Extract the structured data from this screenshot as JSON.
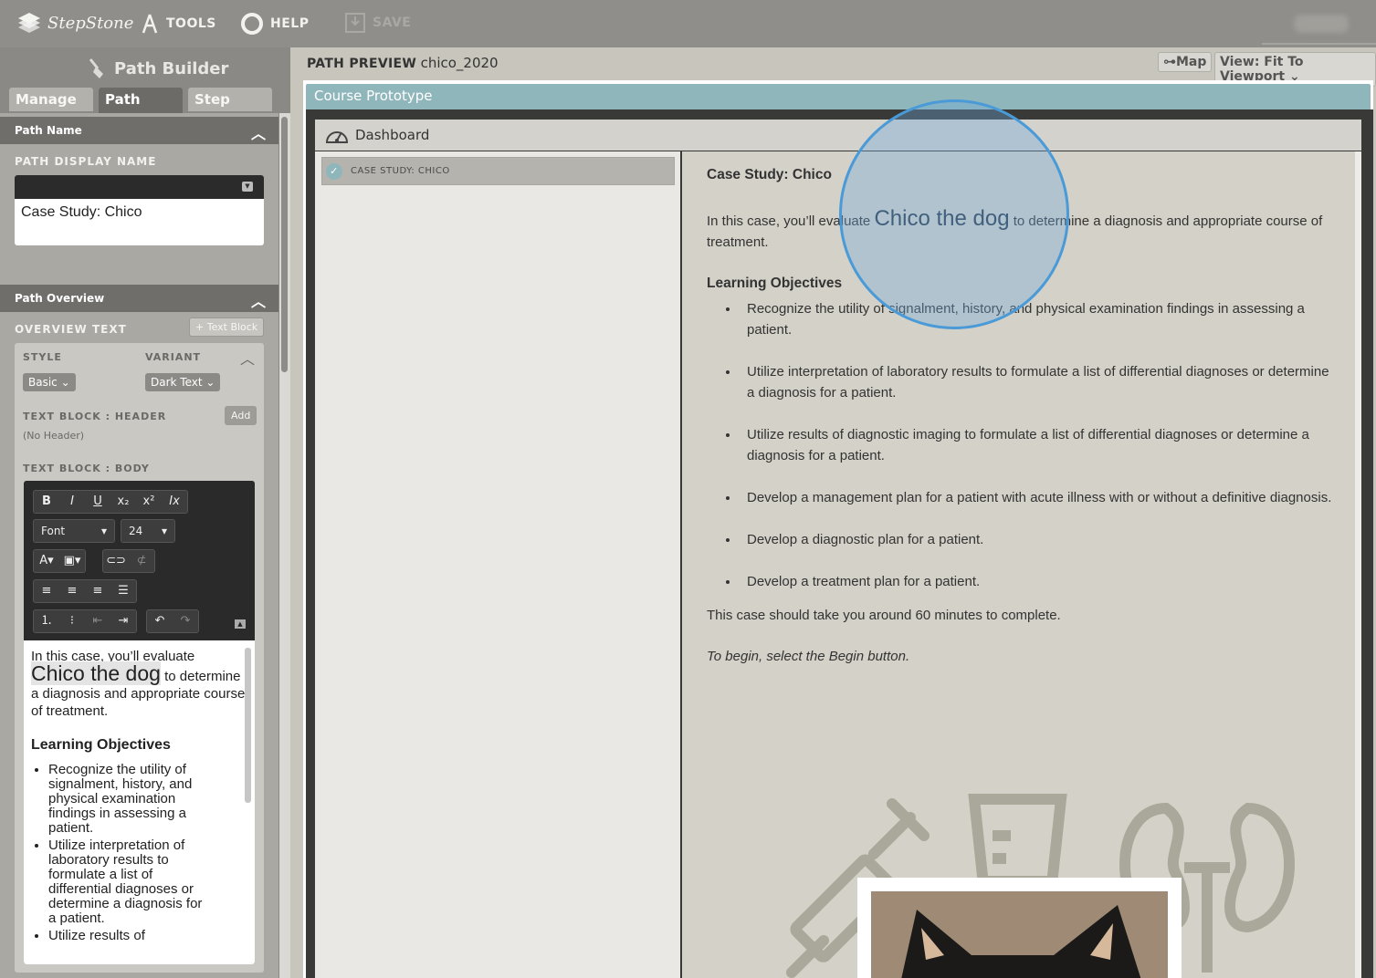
{
  "topbar": {
    "logo_text": "StepStone",
    "tools_label": "TOOLS",
    "help_label": "HELP",
    "save_label": "SAVE"
  },
  "sidebar": {
    "title": "Path Builder",
    "tabs": [
      "Manage",
      "Path",
      "Step"
    ],
    "active_tab": "Path",
    "path_name_header": "Path Name",
    "path_display_name_label": "PATH DISPLAY NAME",
    "path_display_name_value": "Case Study: Chico",
    "path_overview_header": "Path Overview",
    "overview_text_label": "OVERVIEW TEXT",
    "text_block_button": "+ Text Block",
    "style_label": "STYLE",
    "variant_label": "VARIANT",
    "style_value": "Basic",
    "variant_value": "Dark Text",
    "text_block_header_label": "TEXT BLOCK : HEADER",
    "add_button": "Add",
    "no_header": "(No Header)",
    "text_block_body_label": "TEXT BLOCK : BODY",
    "font_select": "Font",
    "size_select": "24"
  },
  "editor": {
    "intro_before": "In this case, you’ll evaluate",
    "intro_big": "Chico the dog",
    "intro_after": "to determine a diagnosis and appropriate course of treatment.",
    "objectives_title": "Learning Objectives",
    "objectives": [
      "Recognize the utility of signalment, history, and physical examination findings in assessing a patient.",
      "Utilize interpretation of laboratory results to formulate a list of differential diagnoses or determine a diagnosis for a patient.",
      "Utilize results of"
    ]
  },
  "main": {
    "path_preview_label": "PATH PREVIEW",
    "path_preview_name": "chico_2020",
    "map_button": "Map",
    "view_select": "View: Fit To Viewport",
    "course_title": "Course Prototype",
    "dashboard_label": "Dashboard",
    "case_item": "CASE STUDY: CHICO"
  },
  "content": {
    "title": "Case Study: Chico",
    "intro_before": "In this case, you’ll evaluate",
    "intro_big": "Chico the dog",
    "intro_after": "to determine a diagnosis and appropriate course of treatment.",
    "objectives_title": "Learning Objectives",
    "objectives": [
      "Recognize the utility of signalment, history, and physical examination findings in assessing a patient.",
      "Utilize interpretation of laboratory results to formulate a list of differential diagnoses or determine a diagnosis for a patient.",
      "Utilize results of diagnostic imaging to formulate a list of differential diagnoses or determine a diagnosis for a patient.",
      "Develop a management plan for a patient with acute illness with or without a definitive diagnosis.",
      "Develop a diagnostic plan for a patient.",
      "Develop a treatment plan for a patient."
    ],
    "duration": "This case should take you around 60 minutes to complete.",
    "instruction": "To begin, select the Begin button."
  }
}
